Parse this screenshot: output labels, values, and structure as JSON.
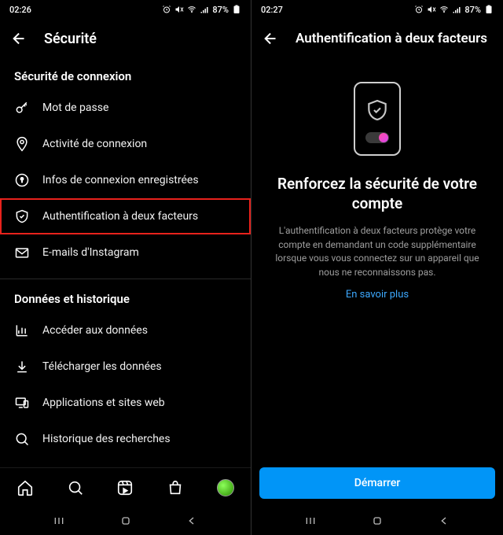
{
  "left": {
    "statusbar": {
      "time": "02:26",
      "battery": "87%"
    },
    "header": {
      "title": "Sécurité"
    },
    "sections": {
      "login": {
        "title": "Sécurité de connexion",
        "password": "Mot de passe",
        "activity": "Activité de connexion",
        "savedInfo": "Infos de connexion enregistrées",
        "twoFactor": "Authentification à deux facteurs",
        "emails": "E-mails d'Instagram"
      },
      "data": {
        "title": "Données et historique",
        "accessData": "Accéder aux données",
        "download": "Télécharger les données",
        "appsWeb": "Applications et sites web",
        "searchHistory": "Historique des recherches"
      }
    }
  },
  "right": {
    "statusbar": {
      "time": "02:27",
      "battery": "87%"
    },
    "header": {
      "title": "Authentification à deux facteurs"
    },
    "heroTitle": "Renforcez la sécurité de votre compte",
    "heroDesc": "L'authentification à deux facteurs protège votre compte en demandant un code supplémentaire lorsque vous vous connectez sur un appareil que nous ne reconnaissons pas.",
    "learnMore": "En savoir plus",
    "startButton": "Démarrer"
  }
}
